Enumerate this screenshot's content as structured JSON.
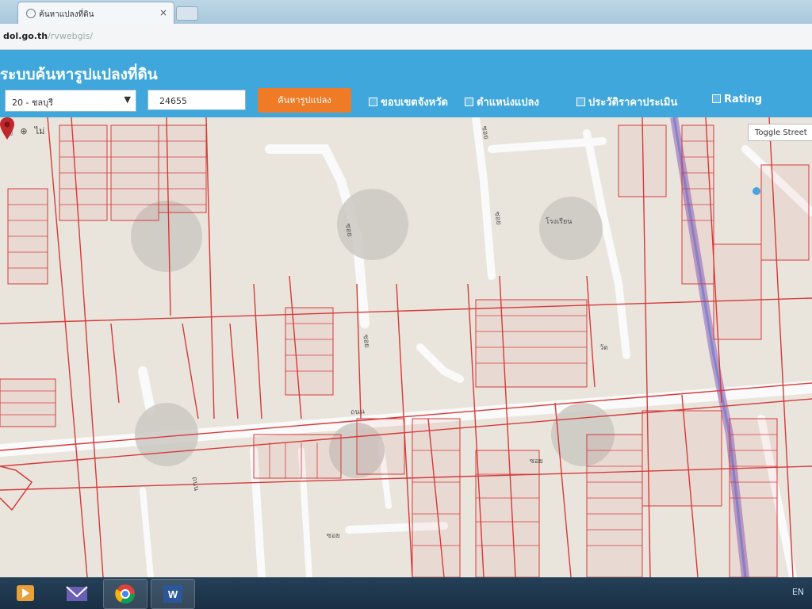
{
  "browser": {
    "tab_title": "ค้นหาแปลงที่ดิน",
    "tab_close": "×",
    "url_host": "dol.go.th",
    "url_path": "/rvwebgis/"
  },
  "app": {
    "title": "ระบบค้นหารูปแปลงที่ดิน",
    "province_select": "20 - ชลบุรี",
    "province_arrow": "▼",
    "parcel_no": "24655",
    "search_button": "ค้นหารูปแปลง",
    "layers": [
      "ขอบเขตจังหวัด",
      "ตำแหน่งแปลง",
      "ประวัติราคาประเมิน",
      "Rating"
    ]
  },
  "map": {
    "tools": [
      "▣",
      "⊕",
      "ไม่"
    ],
    "toggle_label": "Toggle Street",
    "labels": [
      "ซอย",
      "ซอย",
      "ซอย",
      "ซอย",
      "ถนน",
      "ถนน",
      "โรงเรียน",
      "ซอย",
      "วัด",
      "ซอย"
    ],
    "accent_road": "#c8a6d8",
    "parcel_line": "#d63a3a",
    "pin_color": "#c0282c"
  },
  "taskbar": {
    "apps": [
      "media-player-icon",
      "mail-icon",
      "chrome-icon",
      "word-icon"
    ],
    "tray": "EN"
  }
}
